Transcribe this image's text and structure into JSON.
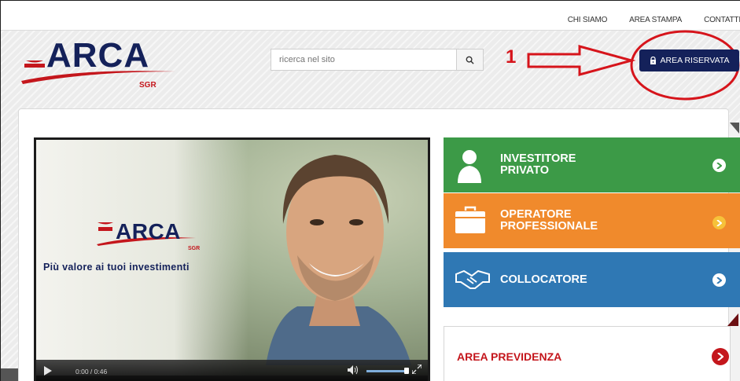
{
  "topnav": {
    "items": [
      "CHI SIAMO",
      "AREA STAMPA",
      "CONTATTI"
    ]
  },
  "logo": {
    "name": "ARCA",
    "sub": "SGR"
  },
  "search": {
    "placeholder": "ricerca nel sito"
  },
  "annotation": {
    "number": "1"
  },
  "area_riservata": {
    "label": "AREA RISERVATA"
  },
  "video": {
    "logo_name": "ARCA",
    "logo_sub": "SGR",
    "tagline": "Più valore ai tuoi investimenti",
    "time": "0:00  /  0:46"
  },
  "tiles": [
    {
      "line1": "INVESTITORE",
      "line2": "PRIVATO",
      "color": "#3c9a47",
      "arrow_color": "#3c9a47",
      "icon": "user-icon"
    },
    {
      "line1": "OPERATORE",
      "line2": "PROFESSIONALE",
      "color": "#f08a2c",
      "arrow_color": "#f0a020",
      "icon": "briefcase-icon"
    },
    {
      "line1": "COLLOCATORE",
      "line2": "",
      "color": "#2f78b4",
      "arrow_color": "#2f78b4",
      "icon": "handshake-icon"
    }
  ],
  "previdenza": {
    "label": "AREA PREVIDENZA",
    "color": "#c4161c"
  },
  "colors": {
    "brand_navy": "#14215a",
    "brand_red": "#c4161c",
    "annotation_red": "#d6141b"
  }
}
